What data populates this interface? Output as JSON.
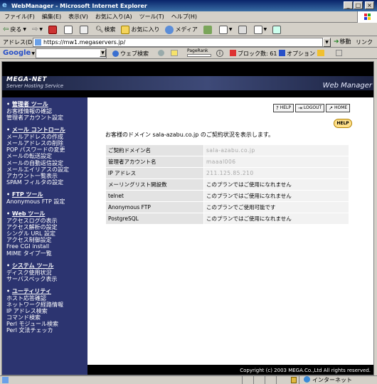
{
  "window": {
    "title": "WebManager - Microsoft Internet Explorer",
    "buttons": [
      "_",
      "□",
      "×"
    ]
  },
  "menu": [
    "ファイル(F)",
    "編集(E)",
    "表示(V)",
    "お気に入り(A)",
    "ツール(T)",
    "ヘルプ(H)"
  ],
  "toolbar": {
    "back": "戻る",
    "search": "検索",
    "favorites": "お気に入り",
    "media": "メディア"
  },
  "address": {
    "label": "アドレス(D)",
    "url": "https://mw1.megaservers.jp/",
    "go": "移動",
    "links": "リンク"
  },
  "googlebar": {
    "logo": "Google",
    "web_search": "ウェブ検索",
    "pagerank": "PageRank",
    "blocked": "ブロック数: 61",
    "options": "オプション"
  },
  "banner": {
    "brand": "MEGA-NET",
    "sub": "Server Hosting Service",
    "right": "Web Manager"
  },
  "sidebar": [
    {
      "title": "管理者 ツール",
      "items": [
        "お客様情報の確認",
        "管理者アカウント設定"
      ]
    },
    {
      "title": "メール コントロール",
      "items": [
        "メールアドレスの作成",
        "メールアドレスの削除",
        "POP パスワードの変更",
        "メールの転送設定",
        "メールの自動返信設定",
        "メールエイリアスの設定",
        "アカウント一覧表示",
        "SPAM フィルタの設定"
      ]
    },
    {
      "title": "FTP ツール",
      "items": [
        "Anonymous FTP 設定"
      ]
    },
    {
      "title": "Web ツール",
      "items": [
        "アクセスログの表示",
        "アクセス解析の設定",
        "シングル URL 設定",
        "アクセス制御設定",
        "Free CGI install",
        "MIME タイプ一覧"
      ]
    },
    {
      "title": "システム ツール",
      "items": [
        "ディスク使用状況",
        "サーバスペック表示"
      ]
    },
    {
      "title": "ユーティリティ",
      "items": [
        "ホスト応答確認",
        "ネットワーク経路情報",
        "IP アドレス検索",
        "コマンド検索",
        "Perl モジュール検索",
        "Perl 文法チェッカ"
      ]
    }
  ],
  "topnav": {
    "help": "HELP",
    "logout": "LOGOUT",
    "home": "HOME"
  },
  "help_badge": "HELP",
  "intro": "お客様のドメイン sala-azabu.co.jp のご契約状況を表示します。",
  "table": [
    {
      "label": "ご契約ドメイン名",
      "value": "sala-azabu.co.jp",
      "blur": true
    },
    {
      "label": "管理者アカウント名",
      "value": "maaal006",
      "blur": true
    },
    {
      "label": "IP アドレス",
      "value": "211.125.85.210",
      "blur": true
    },
    {
      "label": "メーリングリスト開設数",
      "value": "このプランではご使用になれません",
      "blur": false
    },
    {
      "label": "telnet",
      "value": "このプランではご使用になれません",
      "blur": false
    },
    {
      "label": "Anonymous FTP",
      "value": "このプランでご使用可能です",
      "blur": false
    },
    {
      "label": "PostgreSQL",
      "value": "このプランではご使用になれません",
      "blur": false
    }
  ],
  "footer": "Copyright (c) 2003 MEGA.Co.,Ltd All rights reserved.",
  "status": {
    "zone": "インターネット"
  }
}
